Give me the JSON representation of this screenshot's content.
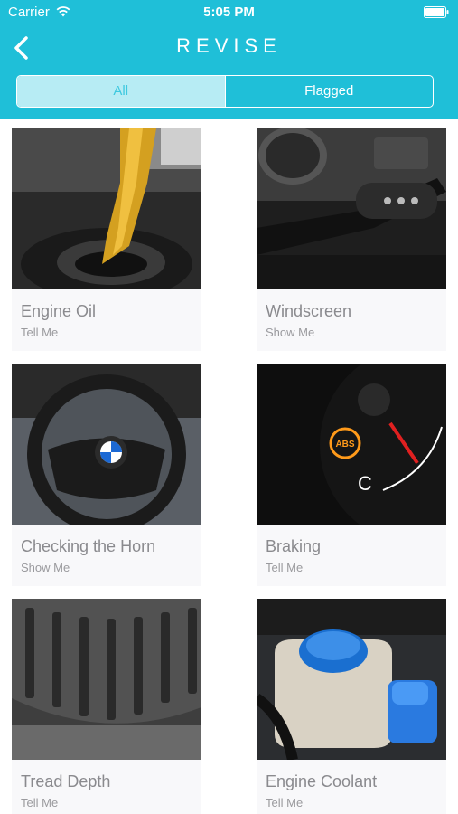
{
  "status_bar": {
    "carrier": "Carrier",
    "time": "5:05 PM"
  },
  "header": {
    "title": "REVISE",
    "back_icon": "chevron-left-icon"
  },
  "segment": {
    "all_label": "All",
    "flagged_label": "Flagged",
    "selected": "All"
  },
  "cards": [
    {
      "title": "Engine Oil",
      "subtitle": "Tell Me"
    },
    {
      "title": "Windscreen",
      "subtitle": "Show Me"
    },
    {
      "title": "Checking the Horn",
      "subtitle": "Show Me"
    },
    {
      "title": "Braking",
      "subtitle": "Tell Me"
    },
    {
      "title": "Tread Depth",
      "subtitle": "Tell Me"
    },
    {
      "title": "Engine Coolant",
      "subtitle": "Tell Me"
    }
  ],
  "colors": {
    "header": "#1fbfd8",
    "segment_active_bg": "#b7ecf4",
    "card_bg": "#f8f8fa"
  }
}
